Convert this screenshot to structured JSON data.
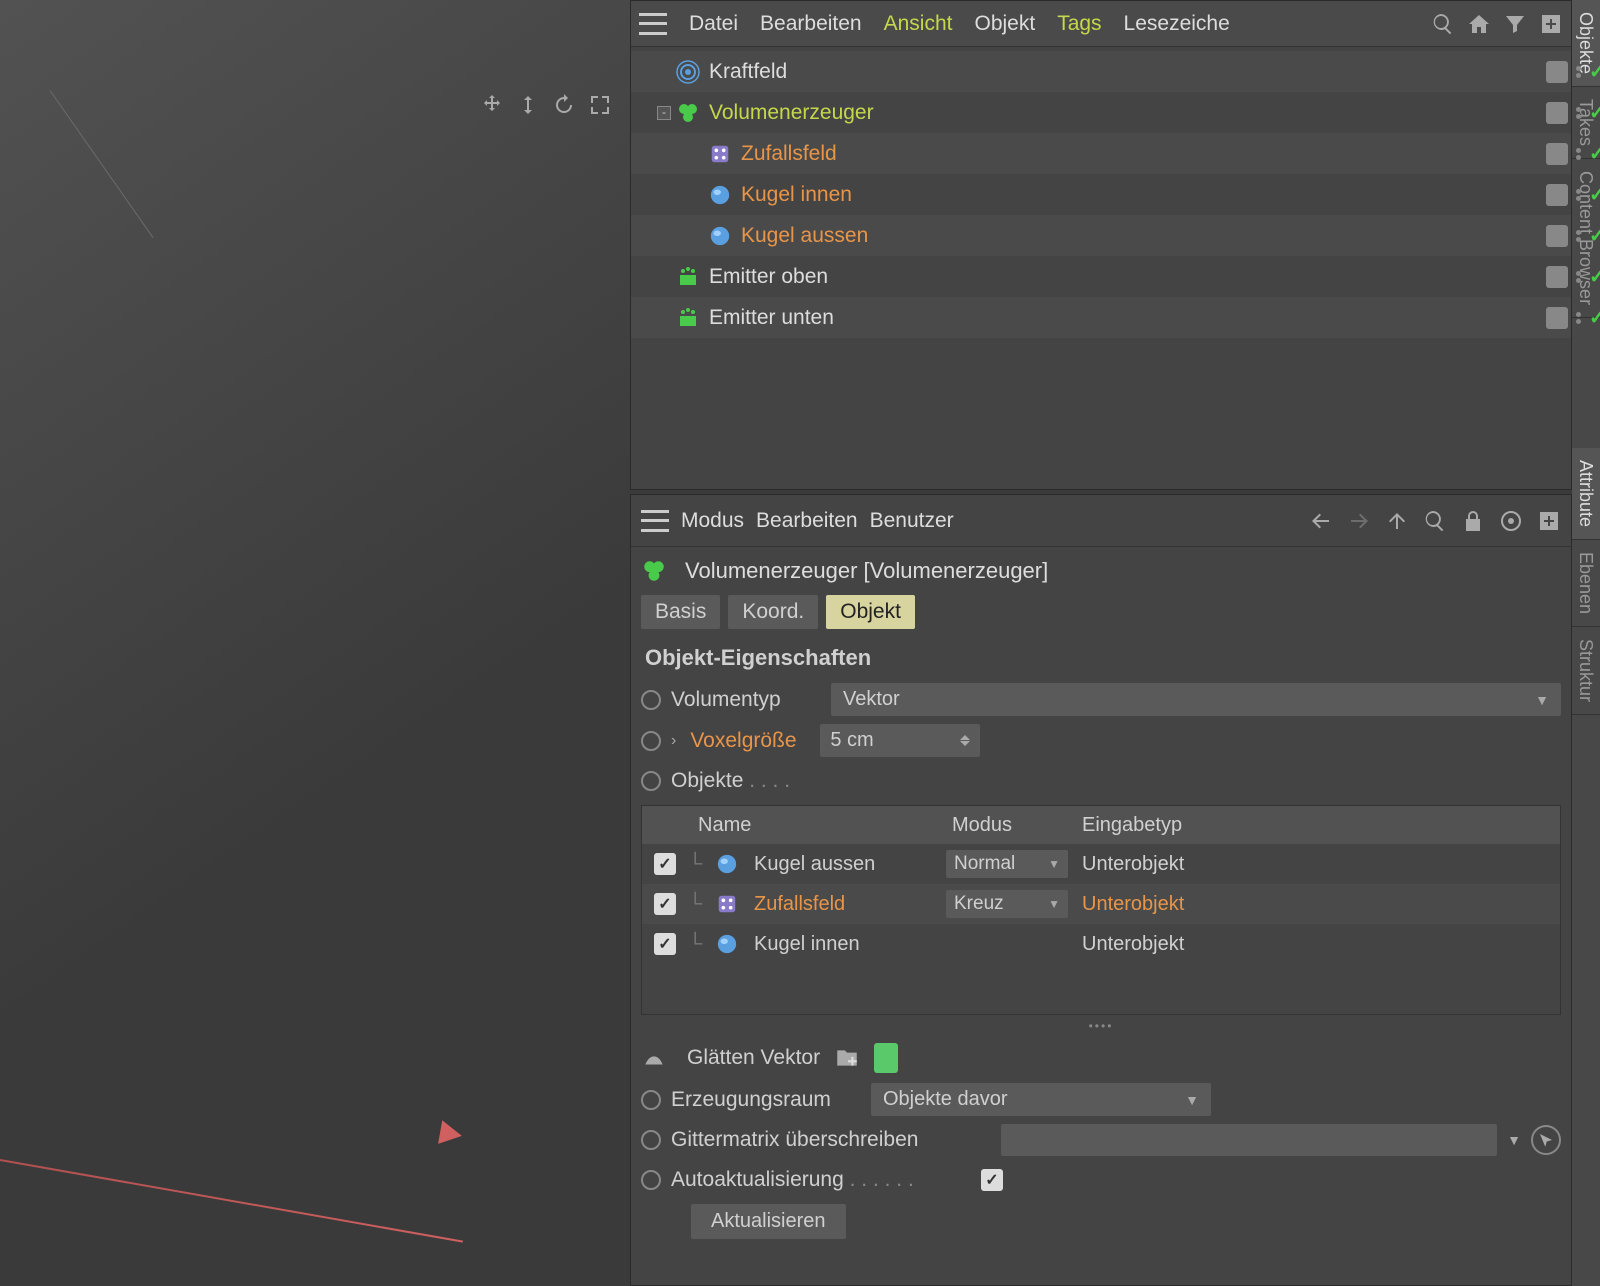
{
  "top_menu": {
    "items": [
      "Datei",
      "Bearbeiten",
      "Ansicht",
      "Objekt",
      "Tags",
      "Lesezeiche"
    ],
    "highlighted": [
      2,
      4
    ]
  },
  "right_tabs": [
    "Objekte",
    "Takes",
    "Content Browser",
    "Attribute",
    "Ebenen",
    "Struktur"
  ],
  "tree": [
    {
      "icon": "forcefield",
      "label": "Kraftfeld",
      "indent": 0,
      "hl": ""
    },
    {
      "icon": "volume",
      "label": "Volumenerzeuger",
      "indent": 0,
      "hl": "yellow",
      "expand": "-"
    },
    {
      "icon": "random",
      "label": "Zufallsfeld",
      "indent": 1,
      "hl": "orange"
    },
    {
      "icon": "sphere",
      "label": "Kugel innen",
      "indent": 1,
      "hl": "orange",
      "dots": true
    },
    {
      "icon": "sphere",
      "label": "Kugel aussen",
      "indent": 1,
      "hl": "orange",
      "dots": true
    },
    {
      "icon": "emitter",
      "label": "Emitter oben",
      "indent": 0,
      "hl": ""
    },
    {
      "icon": "emitter",
      "label": "Emitter unten",
      "indent": 0,
      "hl": ""
    }
  ],
  "attr_menu": [
    "Modus",
    "Bearbeiten",
    "Benutzer"
  ],
  "attr_title": "Volumenerzeuger [Volumenerzeuger]",
  "attr_tabs": [
    "Basis",
    "Koord.",
    "Objekt"
  ],
  "section": "Objekt-Eigenschaften",
  "props": {
    "volumentyp": {
      "label": "Volumentyp",
      "value": "Vektor"
    },
    "voxel": {
      "label": "Voxelgröße",
      "value": "5 cm"
    },
    "objekte": {
      "label": "Objekte"
    }
  },
  "obj_table": {
    "headers": [
      "Name",
      "Modus",
      "Eingabetyp"
    ],
    "rows": [
      {
        "name": "Kugel aussen",
        "mode": "Normal",
        "type": "Unterobjekt",
        "hl": false,
        "icon": "sphere"
      },
      {
        "name": "Zufallsfeld",
        "mode": "Kreuz",
        "type": "Unterobjekt",
        "hl": true,
        "icon": "random"
      },
      {
        "name": "Kugel innen",
        "mode": "",
        "type": "Unterobjekt",
        "hl": false,
        "icon": "sphere"
      }
    ]
  },
  "smooth": {
    "label": "Glätten Vektor"
  },
  "erzeugung": {
    "label": "Erzeugungsraum",
    "value": "Objekte davor"
  },
  "gitter": {
    "label": "Gittermatrix überschreiben"
  },
  "auto": {
    "label": "Autoaktualisierung"
  },
  "update_btn": "Aktualisieren"
}
